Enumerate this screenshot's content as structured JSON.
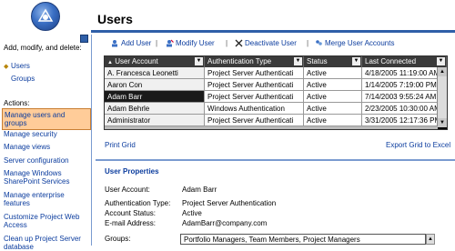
{
  "header": {
    "title": "Users"
  },
  "left_panel": {
    "heading": "Add, modify, and delete:",
    "links": [
      "Users",
      "Groups"
    ],
    "actions_heading": "Actions:",
    "actions": [
      "Manage users and groups",
      "Manage security",
      "Manage views",
      "Server configuration",
      "Manage Windows SharePoint Services",
      "Manage enterprise features",
      "Customize Project Web Access",
      "Clean up Project Server database"
    ]
  },
  "toolbar": {
    "add_user": "Add User",
    "modify_user": "Modify User",
    "deactivate_user": "Deactivate User",
    "merge_user_accounts": "Merge User Accounts",
    "separator": "|"
  },
  "grid": {
    "columns": [
      "User Account",
      "Authentication Type",
      "Status",
      "Last Connected"
    ],
    "sort_indicator": "▲",
    "rows": [
      [
        "A. Francesca Leonetti",
        "Project Server Authenticati",
        "Active",
        "4/18/2005 11:19:00 AM"
      ],
      [
        "Aaron Con",
        "Project Server Authenticati",
        "Active",
        "1/14/2005 7:19:00 PM"
      ],
      [
        "Adam Barr",
        "Project Server Authenticati",
        "Active",
        "7/14/2003 9:55:24 AM"
      ],
      [
        "Adam Behrle",
        "Windows Authentication",
        "Active",
        "2/23/2005 10:30:00 AM"
      ],
      [
        "Administrator",
        "Project Server Authenticati",
        "Active",
        "3/31/2005 12:17:36 PM"
      ]
    ],
    "selected_row": 2
  },
  "print_grid": "Print Grid",
  "export_grid": "Export Grid to Excel",
  "properties": {
    "title": "User Properties",
    "user_account_label": "User Account:",
    "user_account": "Adam Barr",
    "auth_type_label": "Authentication Type:",
    "auth_type": "Project Server Authentication",
    "status_label": "Account Status:",
    "status": "Active",
    "email_label": "E-mail Address:",
    "email": "AdamBarr@company.com",
    "groups_label": "Groups:",
    "groups": "Portfolio Managers, Team Members, Project Managers"
  },
  "colors": {
    "accent": "#2f5fa8",
    "selected_action_bg": "#ffcc99",
    "link": "#0b3c9e"
  },
  "icons": [
    "project-logo-icon",
    "add-user-icon",
    "modify-user-icon",
    "deactivate-user-icon",
    "merge-user-icon"
  ]
}
